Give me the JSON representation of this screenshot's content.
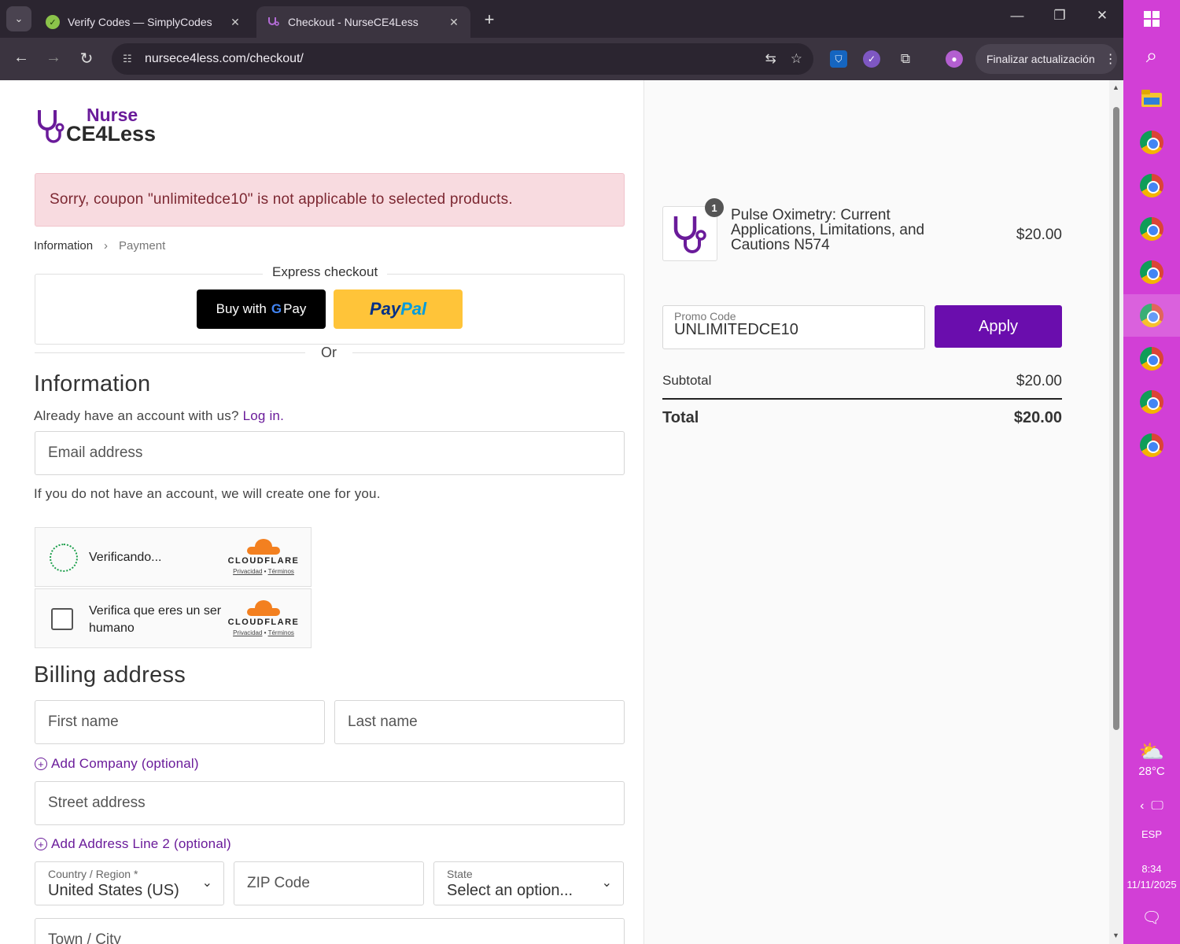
{
  "browser": {
    "tabs": [
      {
        "title": "Verify Codes — SimplyCodes",
        "favicon": "check-icon",
        "color": "#8bc34a"
      },
      {
        "title": "Checkout - NurseCE4Less",
        "favicon": "stethoscope-icon",
        "color": "#6a1b9a"
      }
    ],
    "url": "nursece4less.com/checkout/",
    "update_label": "Finalizar actualización"
  },
  "logo": {
    "line1": "Nurse",
    "line2": "CE4Less"
  },
  "notice": "Sorry, coupon \"unlimitedce10\" is not applicable to selected products.",
  "breadcrumbs": {
    "current": "Information",
    "next": "Payment"
  },
  "express": {
    "label": "Express checkout",
    "gpay_prefix": "Buy with",
    "gpay_g": "G",
    "gpay_suffix": "Pay",
    "paypal_a": "Pay",
    "paypal_b": "Pal",
    "or": "Or"
  },
  "information": {
    "heading": "Information",
    "account_prompt": "Already have an account with us?",
    "login_link": "Log in.",
    "email_placeholder": "Email address",
    "account_note": "If you do not have an account, we will create one for you."
  },
  "captcha": {
    "verifying": "Verificando...",
    "verify_human_1": "Verifica que eres un ser",
    "verify_human_2": "humano",
    "brand": "CLOUDFLARE",
    "privacy": "Privacidad",
    "terms": "Términos",
    "dot": "•"
  },
  "billing": {
    "heading": "Billing address",
    "first_name": "First name",
    "last_name": "Last name",
    "add_company": "Add Company (optional)",
    "street": "Street address",
    "add_line2": "Add Address Line 2 (optional)",
    "country_label": "Country / Region *",
    "country_value": "United States (US)",
    "zip": "ZIP Code",
    "state_label": "State",
    "state_value": "Select an option...",
    "town": "Town / City"
  },
  "order": {
    "qty": "1",
    "product_name": "Pulse Oximetry: Current Applications, Limitations, and Cautions N574",
    "product_price": "$20.00",
    "promo_label": "Promo Code",
    "promo_value": "UNLIMITEDCE10",
    "apply_label": "Apply",
    "subtotal_label": "Subtotal",
    "subtotal_value": "$20.00",
    "total_label": "Total",
    "total_value": "$20.00"
  },
  "taskbar": {
    "temperature": "28°C",
    "lang": "ESP",
    "time": "8:34",
    "date": "11/11/2025"
  },
  "colors": {
    "brand": "#6a1b9a",
    "apply_button": "#6a0dad",
    "taskbar": "#d23fd6",
    "error_bg": "#f8dbe0"
  }
}
